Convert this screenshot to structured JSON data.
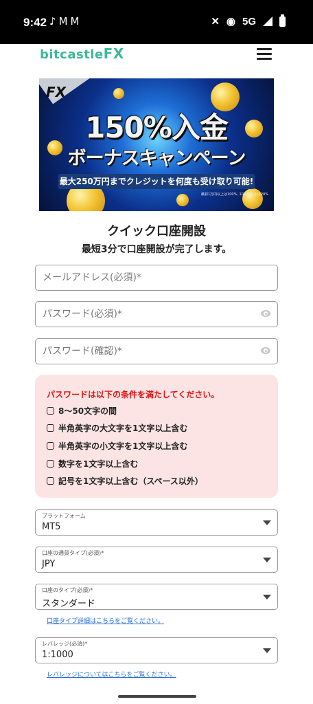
{
  "status_bar": {
    "time": "9:42",
    "left_icons": [
      "tiktok-icon",
      "gmail-icon",
      "gmail-icon"
    ],
    "network": "5G",
    "right_icons": [
      "mute-icon",
      "hotspot-icon",
      "signal-icon",
      "battery-icon"
    ]
  },
  "header": {
    "logo_main": "bitcastle",
    "logo_fx": "FX",
    "menu_icon": "hamburger-menu-icon",
    "brand_color": "#3db89a"
  },
  "banner": {
    "tag": "FX",
    "title_line1": "150%入金",
    "title_line2": "ボーナスキャンペーン",
    "subtitle": "最大250万円までクレジットを何度も受け取り可能!",
    "footnote": "最初1万円以上は100%, 10万円以上は20%"
  },
  "form": {
    "title": "クイック口座開設",
    "subtitle": "最短3分で口座開設が完了します。",
    "email_placeholder": "メールアドレス(必須)*",
    "password_placeholder": "パスワード(必須)*",
    "password_confirm_placeholder": "パスワード(確認)*"
  },
  "password_rules": {
    "title": "パスワードは以下の条件を満たしてください。",
    "items": [
      "8〜50文字の間",
      "半角英字の大文字を1文字以上含む",
      "半角英字の小文字を1文字以上含む",
      "数字を1文字以上含む",
      "記号を1文字以上含む（スペース以外）"
    ],
    "title_color": "#e0120f",
    "background": "#fde4e4"
  },
  "selects": {
    "platform": {
      "label": "プラットフォーム",
      "value": "MT5"
    },
    "currency": {
      "label": "口座の通貨タイプ(必須)*",
      "value": "JPY"
    },
    "account_type": {
      "label": "口座のタイプ(必須)*",
      "value": "スタンダード"
    },
    "leverage": {
      "label": "レバレッジ(必須)*",
      "value": "1:1000"
    }
  },
  "links": {
    "account_type_details": "口座タイプ詳細はこちらをご覧ください。",
    "leverage_details": "レバレッジについてはこちらをご覧ください。"
  }
}
